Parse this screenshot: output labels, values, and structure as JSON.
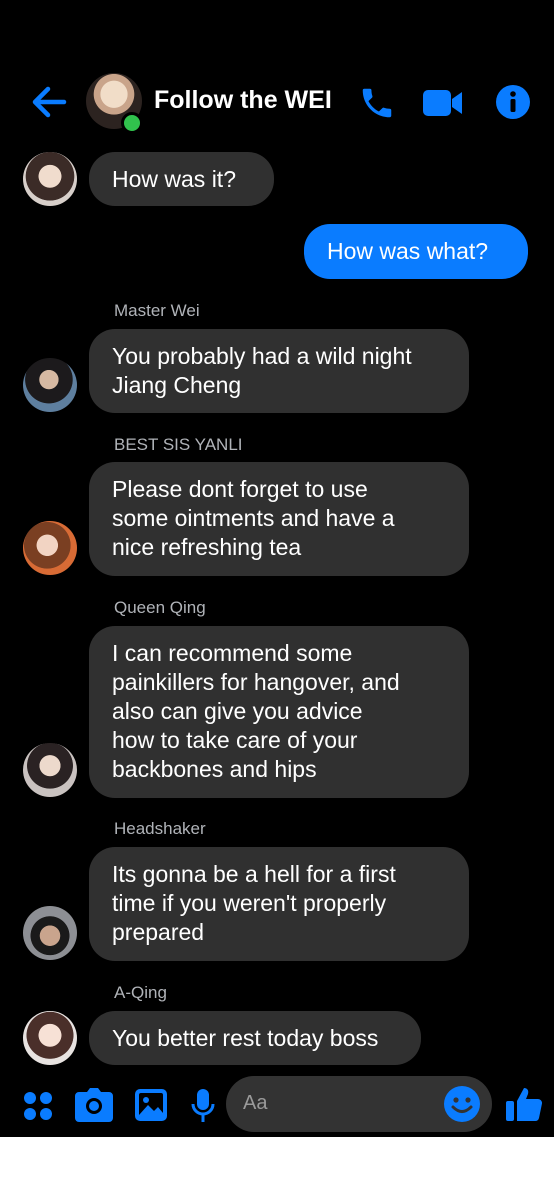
{
  "header": {
    "title": "Follow the WEI"
  },
  "messages": [
    {
      "type": "in",
      "text": "How was it?"
    },
    {
      "type": "out",
      "text": "How was what?"
    },
    {
      "type": "in",
      "sender": "Master Wei",
      "lines": [
        "You probably had a wild night",
        "Jiang Cheng"
      ]
    },
    {
      "type": "in",
      "sender": "BEST SIS YANLI",
      "lines": [
        "Please dont forget to use",
        "some ointments and have a",
        "nice refreshing tea"
      ]
    },
    {
      "type": "in",
      "sender": "Queen Qing",
      "lines": [
        "I can recommend some",
        "painkillers for hangover, and",
        "also can give you advice",
        "how to take care of your",
        "backbones and hips"
      ]
    },
    {
      "type": "in",
      "sender": "Headshaker",
      "lines": [
        "Its gonna be a hell for a first",
        "time if you weren't properly",
        "prepared"
      ]
    },
    {
      "type": "in",
      "sender": "A-Qing",
      "text": "You better rest today boss"
    }
  ],
  "composer": {
    "placeholder": "Aa"
  },
  "colors": {
    "accent": "#0a7cff",
    "bubble_in": "#303030",
    "online": "#31c24d"
  }
}
